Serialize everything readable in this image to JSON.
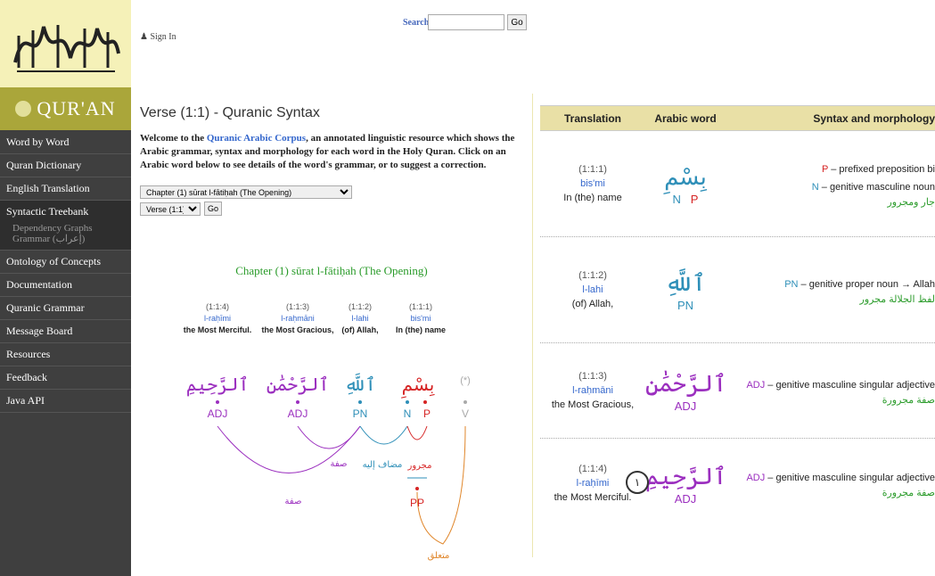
{
  "sidebar": {
    "logo_text": "QUR'AN",
    "items": [
      {
        "label": "Word by Word"
      },
      {
        "label": "Quran Dictionary"
      },
      {
        "label": "English Translation"
      },
      {
        "label": "Syntactic Treebank"
      },
      {
        "label": "Ontology of Concepts"
      },
      {
        "label": "Documentation"
      },
      {
        "label": "Quranic Grammar"
      },
      {
        "label": "Message Board"
      },
      {
        "label": "Resources"
      },
      {
        "label": "Feedback"
      },
      {
        "label": "Java API"
      }
    ],
    "subitems": [
      "Dependency Graphs",
      "Grammar (إعراب)"
    ]
  },
  "header": {
    "sign_in": "Sign In",
    "search_label": "Search",
    "search_value": "",
    "go_label": "Go"
  },
  "page": {
    "title": "Verse (1:1) - Quranic Syntax",
    "intro_prefix": "Welcome to the ",
    "intro_link": "Quranic Arabic Corpus",
    "intro_suffix": ", an annotated linguistic resource which shows the Arabic grammar, syntax and morphology for each word in the Holy Quran. Click on an Arabic word below to see details of the word's grammar, or to suggest a correction.",
    "chapter_selected": "Chapter (1) sūrat l-fātiḥah (The Opening)",
    "verse_selected": "Verse (1:1)",
    "go_label": "Go",
    "chapter_title": "Chapter (1) sūrat l-fātiḥah (The Opening)"
  },
  "treebank": {
    "words": [
      {
        "loc": "(1:1:4)",
        "translit": "l-raḥīmi",
        "english": "the Most Merciful.",
        "arabic": "ٱلرَّحِيمِ",
        "tag": "ADJ",
        "color": "#9b2fbf"
      },
      {
        "loc": "(1:1:3)",
        "translit": "l-raḥmāni",
        "english": "the Most Gracious,",
        "arabic": "ٱلرَّحْمَٰنِ",
        "tag": "ADJ",
        "color": "#9b2fbf"
      },
      {
        "loc": "(1:1:2)",
        "translit": "l-lahi",
        "english": "(of) Allah,",
        "arabic": "ٱللَّهِ",
        "tag": "PN",
        "color": "#2e8fb8"
      },
      {
        "loc": "(1:1:1)",
        "translit": "bis'mi",
        "english": "In (the) name",
        "arabic": "بِسْمِ",
        "tags": [
          "N",
          "P"
        ],
        "colors": [
          "#2e8fb8",
          "#d62424"
        ]
      }
    ],
    "hidden": {
      "loc": "(*)",
      "tag": "V"
    },
    "phrase_tag": "PP",
    "relations": {
      "sifa": "صفة",
      "mudaf": "مضاف إليه",
      "majrur": "مجرور",
      "mutaalliq": "متعلق"
    }
  },
  "wbw": {
    "headers": [
      "Translation",
      "Arabic word",
      "Syntax and morphology"
    ],
    "rows": [
      {
        "loc": "(1:1:1)",
        "translit": "bis'mi",
        "english": "In (the) name",
        "arabic": "بِسْمِ",
        "tags": [
          "N",
          "P"
        ],
        "morph": [
          {
            "tag": "P",
            "text": " – prefixed preposition bi"
          },
          {
            "tag": "N",
            "text": " – genitive masculine noun"
          }
        ],
        "gloss": "جار ومجرور"
      },
      {
        "loc": "(1:1:2)",
        "translit": "l-lahi",
        "english": "(of) Allah,",
        "arabic": "ٱللَّهِ",
        "tags": [
          "PN"
        ],
        "morph": [
          {
            "tag": "PN",
            "text": " – genitive proper noun → Allah"
          }
        ],
        "gloss": "لفظ الجلالة مجرور"
      },
      {
        "loc": "(1:1:3)",
        "translit": "l-raḥmāni",
        "english": "the Most Gracious,",
        "arabic": "ٱلرَّحْمَٰنِ",
        "tags": [
          "ADJ"
        ],
        "morph": [
          {
            "tag": "ADJ",
            "text": " – genitive masculine singular adjective"
          }
        ],
        "gloss": "صفة مجرورة"
      },
      {
        "loc": "(1:1:4)",
        "translit": "l-raḥīmi",
        "english": "the Most Merciful.",
        "arabic": "ٱلرَّحِيمِ",
        "tags": [
          "ADJ"
        ],
        "morph": [
          {
            "tag": "ADJ",
            "text": " – genitive masculine singular adjective"
          }
        ],
        "gloss": "صفة مجرورة"
      }
    ],
    "verse_marker": "١"
  }
}
